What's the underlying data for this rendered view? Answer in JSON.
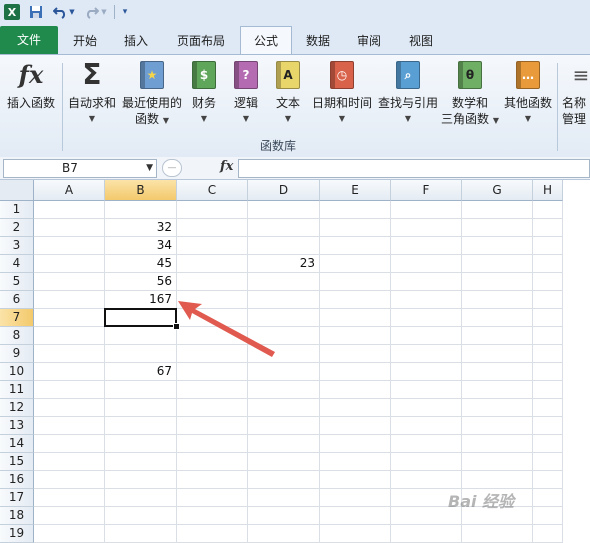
{
  "qat": {
    "app_icon": "excel-logo",
    "buttons": [
      "save-icon",
      "undo-icon",
      "redo-icon",
      "customize-dropdown-icon"
    ]
  },
  "tabs": {
    "file": "文件",
    "items": [
      "开始",
      "插入",
      "页面布局",
      "公式",
      "数据",
      "审阅",
      "视图"
    ],
    "active": "公式"
  },
  "ribbon": {
    "buttons": [
      {
        "id": "insert-function",
        "line1": "插入函数",
        "line2": "",
        "icon": "fx"
      },
      {
        "id": "autosum",
        "line1": "自动求和",
        "line2": "",
        "icon": "Σ"
      },
      {
        "id": "recently-used",
        "line1": "最近使用的",
        "line2": "函数",
        "icon": "★"
      },
      {
        "id": "financial",
        "line1": "财务",
        "line2": "",
        "icon": "$"
      },
      {
        "id": "logical",
        "line1": "逻辑",
        "line2": "",
        "icon": "?"
      },
      {
        "id": "text",
        "line1": "文本",
        "line2": "",
        "icon": "A"
      },
      {
        "id": "date-time",
        "line1": "日期和时间",
        "line2": "",
        "icon": "◷"
      },
      {
        "id": "lookup-reference",
        "line1": "查找与引用",
        "line2": "",
        "icon": "⌕"
      },
      {
        "id": "math-trig",
        "line1": "数学和",
        "line2": "三角函数",
        "icon": "θ"
      },
      {
        "id": "more-functions",
        "line1": "其他函数",
        "line2": "",
        "icon": "…"
      },
      {
        "id": "name-manager",
        "line1": "名称",
        "line2": "管理",
        "icon": "≡"
      }
    ],
    "group_label": "函数库",
    "colors": {
      "recently-used": "#6f9fd2",
      "financial": "#5fa55a",
      "logical": "#b46bb1",
      "text": "#e8d66b",
      "date-time": "#d9634a",
      "lookup-reference": "#5a9fd4",
      "math-trig": "#6fae65",
      "more-functions": "#e99a3a"
    }
  },
  "formula_bar": {
    "name_box": "B7",
    "fx_label": "fx",
    "value": ""
  },
  "grid": {
    "columns": [
      "A",
      "B",
      "C",
      "D",
      "E",
      "F",
      "G",
      "H"
    ],
    "selected_column": "B",
    "rows": [
      "1",
      "2",
      "3",
      "4",
      "5",
      "6",
      "7",
      "8",
      "9",
      "10",
      "11",
      "12",
      "13",
      "14",
      "15",
      "16",
      "17",
      "18",
      "19"
    ],
    "selected_row": "7",
    "cells": [
      {
        "ref": "B2",
        "value": "32"
      },
      {
        "ref": "B3",
        "value": "34"
      },
      {
        "ref": "B4",
        "value": "45"
      },
      {
        "ref": "D4",
        "value": "23"
      },
      {
        "ref": "B5",
        "value": "56"
      },
      {
        "ref": "B6",
        "value": "167"
      },
      {
        "ref": "B10",
        "value": "67"
      }
    ],
    "active_cell": "B7"
  },
  "annotation": {
    "arrow_color": "#e05a4f"
  },
  "watermark": "Bai 经验"
}
